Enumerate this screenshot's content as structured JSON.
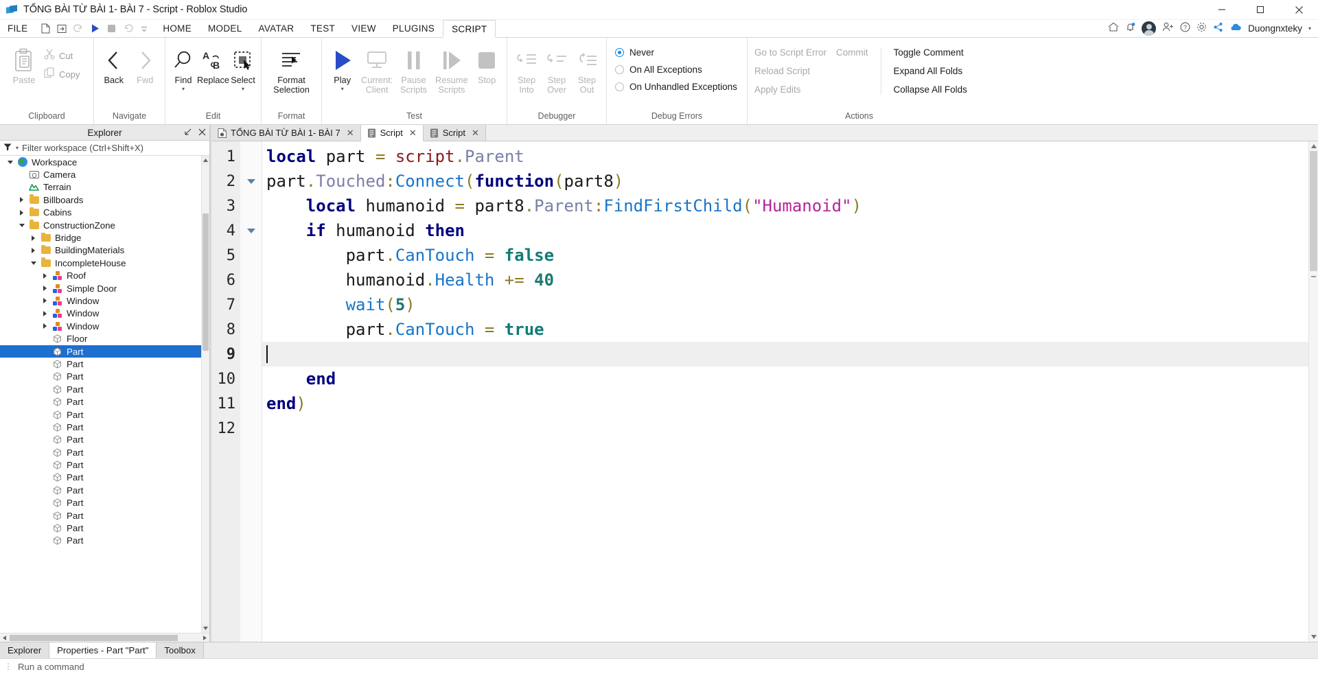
{
  "window": {
    "title": "TỔNG BÀI TỪ BÀI 1- BÀI 7 - Script - Roblox Studio",
    "minimize": "minimize-icon",
    "maximize": "maximize-icon",
    "close": "close-icon"
  },
  "menubar": {
    "file": "FILE",
    "quick_access": [
      "new-file-icon",
      "open-file-icon",
      "redo-icon",
      "play-icon",
      "stop-icon",
      "undo-icon",
      "more-icon"
    ],
    "tabs": [
      {
        "label": "HOME",
        "active": false
      },
      {
        "label": "MODEL",
        "active": false
      },
      {
        "label": "AVATAR",
        "active": false
      },
      {
        "label": "TEST",
        "active": false
      },
      {
        "label": "VIEW",
        "active": false
      },
      {
        "label": "PLUGINS",
        "active": false
      },
      {
        "label": "SCRIPT",
        "active": true
      }
    ],
    "right_icons": [
      "home-icon",
      "notification-icon",
      "avatar-icon",
      "add-person-icon",
      "help-icon",
      "settings-icon",
      "share-icon",
      "cloud-icon"
    ],
    "user": "Duongnxteky",
    "user_caret": "▾"
  },
  "ribbon": {
    "groups": [
      {
        "label": "Clipboard",
        "big": [
          {
            "label": "Paste",
            "icon": "paste-icon",
            "disabled": true
          }
        ],
        "small": [
          {
            "label": "Cut",
            "icon": "cut-icon"
          },
          {
            "label": "Copy",
            "icon": "copy-icon"
          }
        ]
      },
      {
        "label": "Navigate",
        "big": [
          {
            "label": "Back",
            "icon": "back-arrow-icon",
            "disabled": false
          },
          {
            "label": "Fwd",
            "icon": "forward-arrow-icon",
            "disabled": true
          }
        ]
      },
      {
        "label": "Edit",
        "big": [
          {
            "label": "Find",
            "icon": "magnifier-icon",
            "caret": true
          },
          {
            "label": "Replace",
            "icon": "replace-ab-icon"
          },
          {
            "label": "Select",
            "icon": "select-cursor-icon",
            "caret": true
          }
        ]
      },
      {
        "label": "Format",
        "big": [
          {
            "label": "Format Selection",
            "icon": "format-lines-icon",
            "caret": true
          }
        ]
      },
      {
        "label": "Test",
        "big": [
          {
            "label": "Play",
            "icon": "play-triangle-icon",
            "caret": true
          },
          {
            "label": "Current: Client",
            "icon": "monitor-icon",
            "disabled": true
          },
          {
            "label": "Pause Scripts",
            "icon": "pause-icon",
            "disabled": true
          },
          {
            "label": "Resume Scripts",
            "icon": "resume-icon",
            "disabled": true
          },
          {
            "label": "Stop",
            "icon": "stop-square-icon",
            "disabled": true
          }
        ]
      },
      {
        "label": "Debugger",
        "big": [
          {
            "label": "Step Into",
            "icon": "step-into-icon",
            "disabled": true
          },
          {
            "label": "Step Over",
            "icon": "step-over-icon",
            "disabled": true
          },
          {
            "label": "Step Out",
            "icon": "step-out-icon",
            "disabled": true
          }
        ]
      }
    ],
    "debug_errors": {
      "label": "Debug Errors",
      "options": [
        {
          "label": "Never",
          "selected": true
        },
        {
          "label": "On All Exceptions",
          "selected": false
        },
        {
          "label": "On Unhandled Exceptions",
          "selected": false
        }
      ]
    },
    "actions": {
      "label": "Actions",
      "col1": [
        {
          "label": "Go to Script Error",
          "disabled": true
        },
        {
          "label": "Reload Script",
          "disabled": true
        },
        {
          "label": "Apply Edits",
          "disabled": true
        }
      ],
      "col2": [
        {
          "label": "Commit",
          "disabled": true
        }
      ],
      "col3": [
        {
          "label": "Toggle Comment",
          "disabled": false
        },
        {
          "label": "Expand All Folds",
          "disabled": false
        },
        {
          "label": "Collapse All Folds",
          "disabled": false
        }
      ]
    }
  },
  "explorer": {
    "title": "Explorer",
    "undock_icon": "undock-icon",
    "close_icon": "close-icon",
    "filter_placeholder": "Filter workspace (Ctrl+Shift+X)",
    "filter_icon": "filter-icon",
    "tree": [
      {
        "label": "Workspace",
        "depth": 0,
        "icon": "globe",
        "arrow": "open",
        "selected": false
      },
      {
        "label": "Camera",
        "depth": 1,
        "icon": "camera",
        "arrow": "none",
        "selected": false
      },
      {
        "label": "Terrain",
        "depth": 1,
        "icon": "terrain",
        "arrow": "none",
        "selected": false
      },
      {
        "label": "Billboards",
        "depth": 1,
        "icon": "folder",
        "arrow": "closed",
        "selected": false
      },
      {
        "label": "Cabins",
        "depth": 1,
        "icon": "folder",
        "arrow": "closed",
        "selected": false
      },
      {
        "label": "ConstructionZone",
        "depth": 1,
        "icon": "folder",
        "arrow": "open",
        "selected": false
      },
      {
        "label": "Bridge",
        "depth": 2,
        "icon": "folder",
        "arrow": "closed",
        "selected": false
      },
      {
        "label": "BuildingMaterials",
        "depth": 2,
        "icon": "folder",
        "arrow": "closed",
        "selected": false
      },
      {
        "label": "IncompleteHouse",
        "depth": 2,
        "icon": "folder",
        "arrow": "open",
        "selected": false
      },
      {
        "label": "Roof",
        "depth": 3,
        "icon": "model",
        "arrow": "closed",
        "selected": false
      },
      {
        "label": "Simple Door",
        "depth": 3,
        "icon": "model",
        "arrow": "closed",
        "selected": false
      },
      {
        "label": "Window",
        "depth": 3,
        "icon": "model",
        "arrow": "closed",
        "selected": false
      },
      {
        "label": "Window",
        "depth": 3,
        "icon": "model",
        "arrow": "closed",
        "selected": false
      },
      {
        "label": "Window",
        "depth": 3,
        "icon": "model",
        "arrow": "closed",
        "selected": false
      },
      {
        "label": "Floor",
        "depth": 3,
        "icon": "cube",
        "arrow": "none",
        "selected": false
      },
      {
        "label": "Part",
        "depth": 3,
        "icon": "cube",
        "arrow": "none",
        "selected": true
      },
      {
        "label": "Part",
        "depth": 3,
        "icon": "cube",
        "arrow": "none",
        "selected": false
      },
      {
        "label": "Part",
        "depth": 3,
        "icon": "cube",
        "arrow": "none",
        "selected": false
      },
      {
        "label": "Part",
        "depth": 3,
        "icon": "cube",
        "arrow": "none",
        "selected": false
      },
      {
        "label": "Part",
        "depth": 3,
        "icon": "cube",
        "arrow": "none",
        "selected": false
      },
      {
        "label": "Part",
        "depth": 3,
        "icon": "cube",
        "arrow": "none",
        "selected": false
      },
      {
        "label": "Part",
        "depth": 3,
        "icon": "cube",
        "arrow": "none",
        "selected": false
      },
      {
        "label": "Part",
        "depth": 3,
        "icon": "cube",
        "arrow": "none",
        "selected": false
      },
      {
        "label": "Part",
        "depth": 3,
        "icon": "cube",
        "arrow": "none",
        "selected": false
      },
      {
        "label": "Part",
        "depth": 3,
        "icon": "cube",
        "arrow": "none",
        "selected": false
      },
      {
        "label": "Part",
        "depth": 3,
        "icon": "cube",
        "arrow": "none",
        "selected": false
      },
      {
        "label": "Part",
        "depth": 3,
        "icon": "cube",
        "arrow": "none",
        "selected": false
      },
      {
        "label": "Part",
        "depth": 3,
        "icon": "cube",
        "arrow": "none",
        "selected": false
      },
      {
        "label": "Part",
        "depth": 3,
        "icon": "cube",
        "arrow": "none",
        "selected": false
      },
      {
        "label": "Part",
        "depth": 3,
        "icon": "cube",
        "arrow": "none",
        "selected": false
      },
      {
        "label": "Part",
        "depth": 3,
        "icon": "cube",
        "arrow": "none",
        "selected": false
      }
    ]
  },
  "editor": {
    "tabs": [
      {
        "label": "TỔNG BÀI TỪ BÀI 1- BÀI 7",
        "icon": "place-icon",
        "active": false
      },
      {
        "label": "Script",
        "icon": "script-icon",
        "active": true
      },
      {
        "label": "Script",
        "icon": "script-icon",
        "active": false
      }
    ],
    "close_glyph": "✕",
    "line_numbers": [
      "1",
      "2",
      "3",
      "4",
      "5",
      "6",
      "7",
      "8",
      "9",
      "10",
      "11",
      "12"
    ],
    "current_line": 9,
    "fold_lines": [
      2,
      4
    ],
    "code": [
      {
        "n": 1,
        "indent": 0,
        "tokens": [
          {
            "t": "local",
            "c": "kw"
          },
          {
            "t": " part ",
            "c": "plain"
          },
          {
            "t": "=",
            "c": "op"
          },
          {
            "t": " ",
            "c": "plain"
          },
          {
            "t": "script",
            "c": "glob"
          },
          {
            "t": ".",
            "c": "op"
          },
          {
            "t": "Parent",
            "c": "prop"
          }
        ]
      },
      {
        "n": 2,
        "indent": 0,
        "tokens": [
          {
            "t": "part",
            "c": "plain"
          },
          {
            "t": ".",
            "c": "op"
          },
          {
            "t": "Touched",
            "c": "prop"
          },
          {
            "t": ":",
            "c": "op"
          },
          {
            "t": "Connect",
            "c": "meth"
          },
          {
            "t": "(",
            "c": "paren"
          },
          {
            "t": "function",
            "c": "fn"
          },
          {
            "t": "(",
            "c": "paren"
          },
          {
            "t": "part8",
            "c": "plain"
          },
          {
            "t": ")",
            "c": "paren"
          }
        ]
      },
      {
        "n": 3,
        "indent": 1,
        "tokens": [
          {
            "t": "local",
            "c": "kw"
          },
          {
            "t": " humanoid ",
            "c": "plain"
          },
          {
            "t": "=",
            "c": "op"
          },
          {
            "t": " ",
            "c": "plain"
          },
          {
            "t": "part8",
            "c": "plain"
          },
          {
            "t": ".",
            "c": "op"
          },
          {
            "t": "Parent",
            "c": "prop"
          },
          {
            "t": ":",
            "c": "op"
          },
          {
            "t": "FindFirstChild",
            "c": "meth"
          },
          {
            "t": "(",
            "c": "paren"
          },
          {
            "t": "\"Humanoid\"",
            "c": "str"
          },
          {
            "t": ")",
            "c": "paren"
          }
        ]
      },
      {
        "n": 4,
        "indent": 1,
        "tokens": [
          {
            "t": "if",
            "c": "kw"
          },
          {
            "t": " humanoid ",
            "c": "plain"
          },
          {
            "t": "then",
            "c": "kw"
          }
        ]
      },
      {
        "n": 5,
        "indent": 2,
        "tokens": [
          {
            "t": "part",
            "c": "plain"
          },
          {
            "t": ".",
            "c": "op"
          },
          {
            "t": "CanTouch",
            "c": "meth"
          },
          {
            "t": " ",
            "c": "plain"
          },
          {
            "t": "=",
            "c": "op"
          },
          {
            "t": " ",
            "c": "plain"
          },
          {
            "t": "false",
            "c": "bool"
          }
        ]
      },
      {
        "n": 6,
        "indent": 2,
        "tokens": [
          {
            "t": "humanoid",
            "c": "plain"
          },
          {
            "t": ".",
            "c": "op"
          },
          {
            "t": "Health",
            "c": "meth"
          },
          {
            "t": " ",
            "c": "plain"
          },
          {
            "t": "+=",
            "c": "op"
          },
          {
            "t": " ",
            "c": "plain"
          },
          {
            "t": "40",
            "c": "num"
          }
        ]
      },
      {
        "n": 7,
        "indent": 2,
        "tokens": [
          {
            "t": "wait",
            "c": "meth"
          },
          {
            "t": "(",
            "c": "paren"
          },
          {
            "t": "5",
            "c": "num"
          },
          {
            "t": ")",
            "c": "paren"
          }
        ]
      },
      {
        "n": 8,
        "indent": 2,
        "tokens": [
          {
            "t": "part",
            "c": "plain"
          },
          {
            "t": ".",
            "c": "op"
          },
          {
            "t": "CanTouch",
            "c": "meth"
          },
          {
            "t": " ",
            "c": "plain"
          },
          {
            "t": "=",
            "c": "op"
          },
          {
            "t": " ",
            "c": "plain"
          },
          {
            "t": "true",
            "c": "bool"
          }
        ]
      },
      {
        "n": 9,
        "indent": 0,
        "tokens": []
      },
      {
        "n": 10,
        "indent": 1,
        "tokens": [
          {
            "t": "end",
            "c": "kw"
          }
        ]
      },
      {
        "n": 11,
        "indent": 0,
        "tokens": [
          {
            "t": "end",
            "c": "kw"
          },
          {
            "t": ")",
            "c": "paren"
          }
        ]
      },
      {
        "n": 12,
        "indent": 0,
        "tokens": []
      }
    ]
  },
  "bottom": {
    "tabs": [
      {
        "label": "Explorer",
        "active": false
      },
      {
        "label": "Properties - Part \"Part\"",
        "active": true
      },
      {
        "label": "Toolbox",
        "active": false
      }
    ],
    "command_placeholder": "Run a command"
  },
  "colors": {
    "accent_blue": "#1d6fd0",
    "play_blue": "#2a4cc7",
    "keyword": "#00007f",
    "string": "#b3249a",
    "number": "#1d7a6e",
    "method": "#1874c8",
    "global": "#8b1a1a",
    "operator": "#8a7c23",
    "property": "#7a7fa8",
    "selection": "#1d6fd0",
    "radio_on": "#0a8ae8"
  }
}
